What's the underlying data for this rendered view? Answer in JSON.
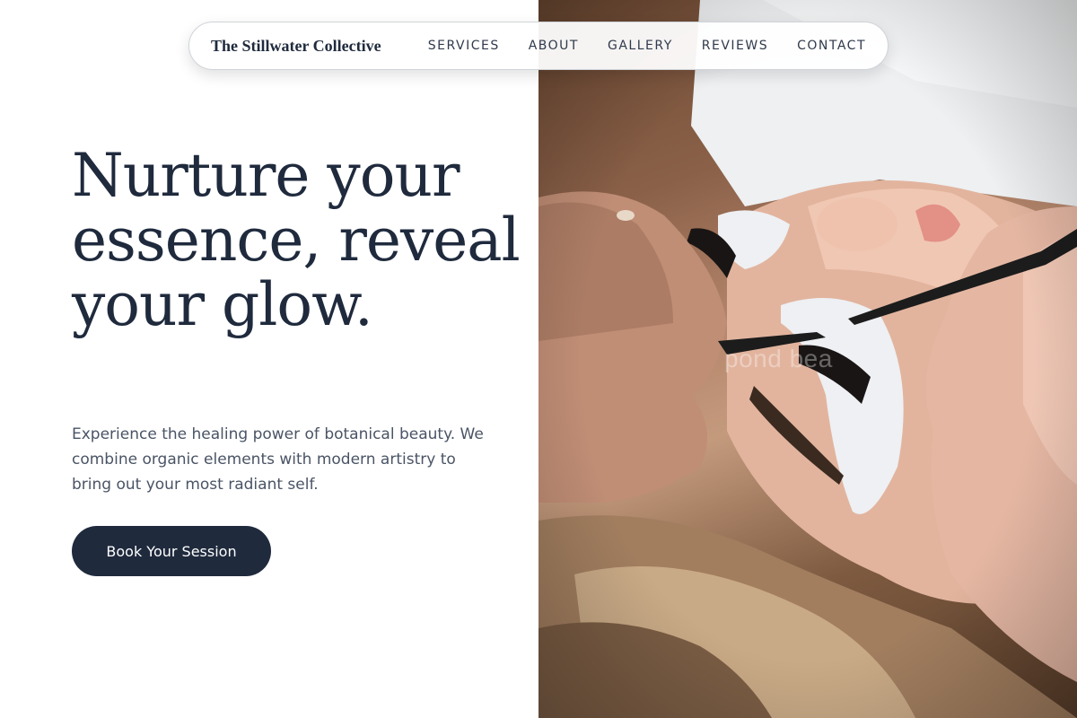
{
  "brand": {
    "name": "The Stillwater Collective"
  },
  "nav": {
    "items": [
      {
        "label": "SERVICES"
      },
      {
        "label": "ABOUT"
      },
      {
        "label": "GALLERY"
      },
      {
        "label": "REVIEWS"
      },
      {
        "label": "CONTACT"
      }
    ]
  },
  "hero": {
    "title": "Nurture your essence, reveal your glow.",
    "description": "Experience the healing power of botanical beauty. We combine organic elements with modern artistry to bring out your most radiant self.",
    "cta_label": "Book Your Session"
  },
  "photo": {
    "watermark": "pond bea"
  },
  "colors": {
    "primary": "#1f2a3d",
    "body_text": "#4a5465",
    "background": "#ffffff"
  }
}
